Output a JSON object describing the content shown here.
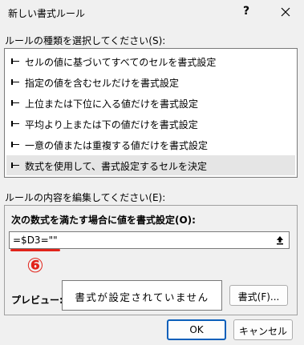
{
  "window": {
    "title": "新しい書式ルール",
    "help_glyph": "?",
    "close_icon": "close-icon"
  },
  "rule_type": {
    "label": "ルールの種類を選択してください(S):",
    "items": [
      {
        "label": "セルの値に基づいてすべてのセルを書式設定",
        "selected": false
      },
      {
        "label": "指定の値を含むセルだけを書式設定",
        "selected": false
      },
      {
        "label": "上位または下位に入る値だけを書式設定",
        "selected": false
      },
      {
        "label": "平均より上または下の値だけを書式設定",
        "selected": false
      },
      {
        "label": "一意の値または重複する値だけを書式設定",
        "selected": false
      },
      {
        "label": "数式を使用して、書式設定するセルを決定",
        "selected": true
      }
    ]
  },
  "rule_content": {
    "label": "ルールの内容を編集してください(E):",
    "formula_label": "次の数式を満たす場合に値を書式設定(O):",
    "formula_value": "=$D3=\"\"",
    "annotation_marker": "⑥",
    "annotation_color": "#e2231a",
    "preview_label": "プレビュー:",
    "preview_text": "書式が設定されていません",
    "format_button": "書式(F)..."
  },
  "footer": {
    "ok_label": "OK",
    "cancel_label": "キャンセル"
  },
  "colors": {
    "selected_row": "#e5e5e5",
    "default_button_border": "#0b5fba"
  }
}
